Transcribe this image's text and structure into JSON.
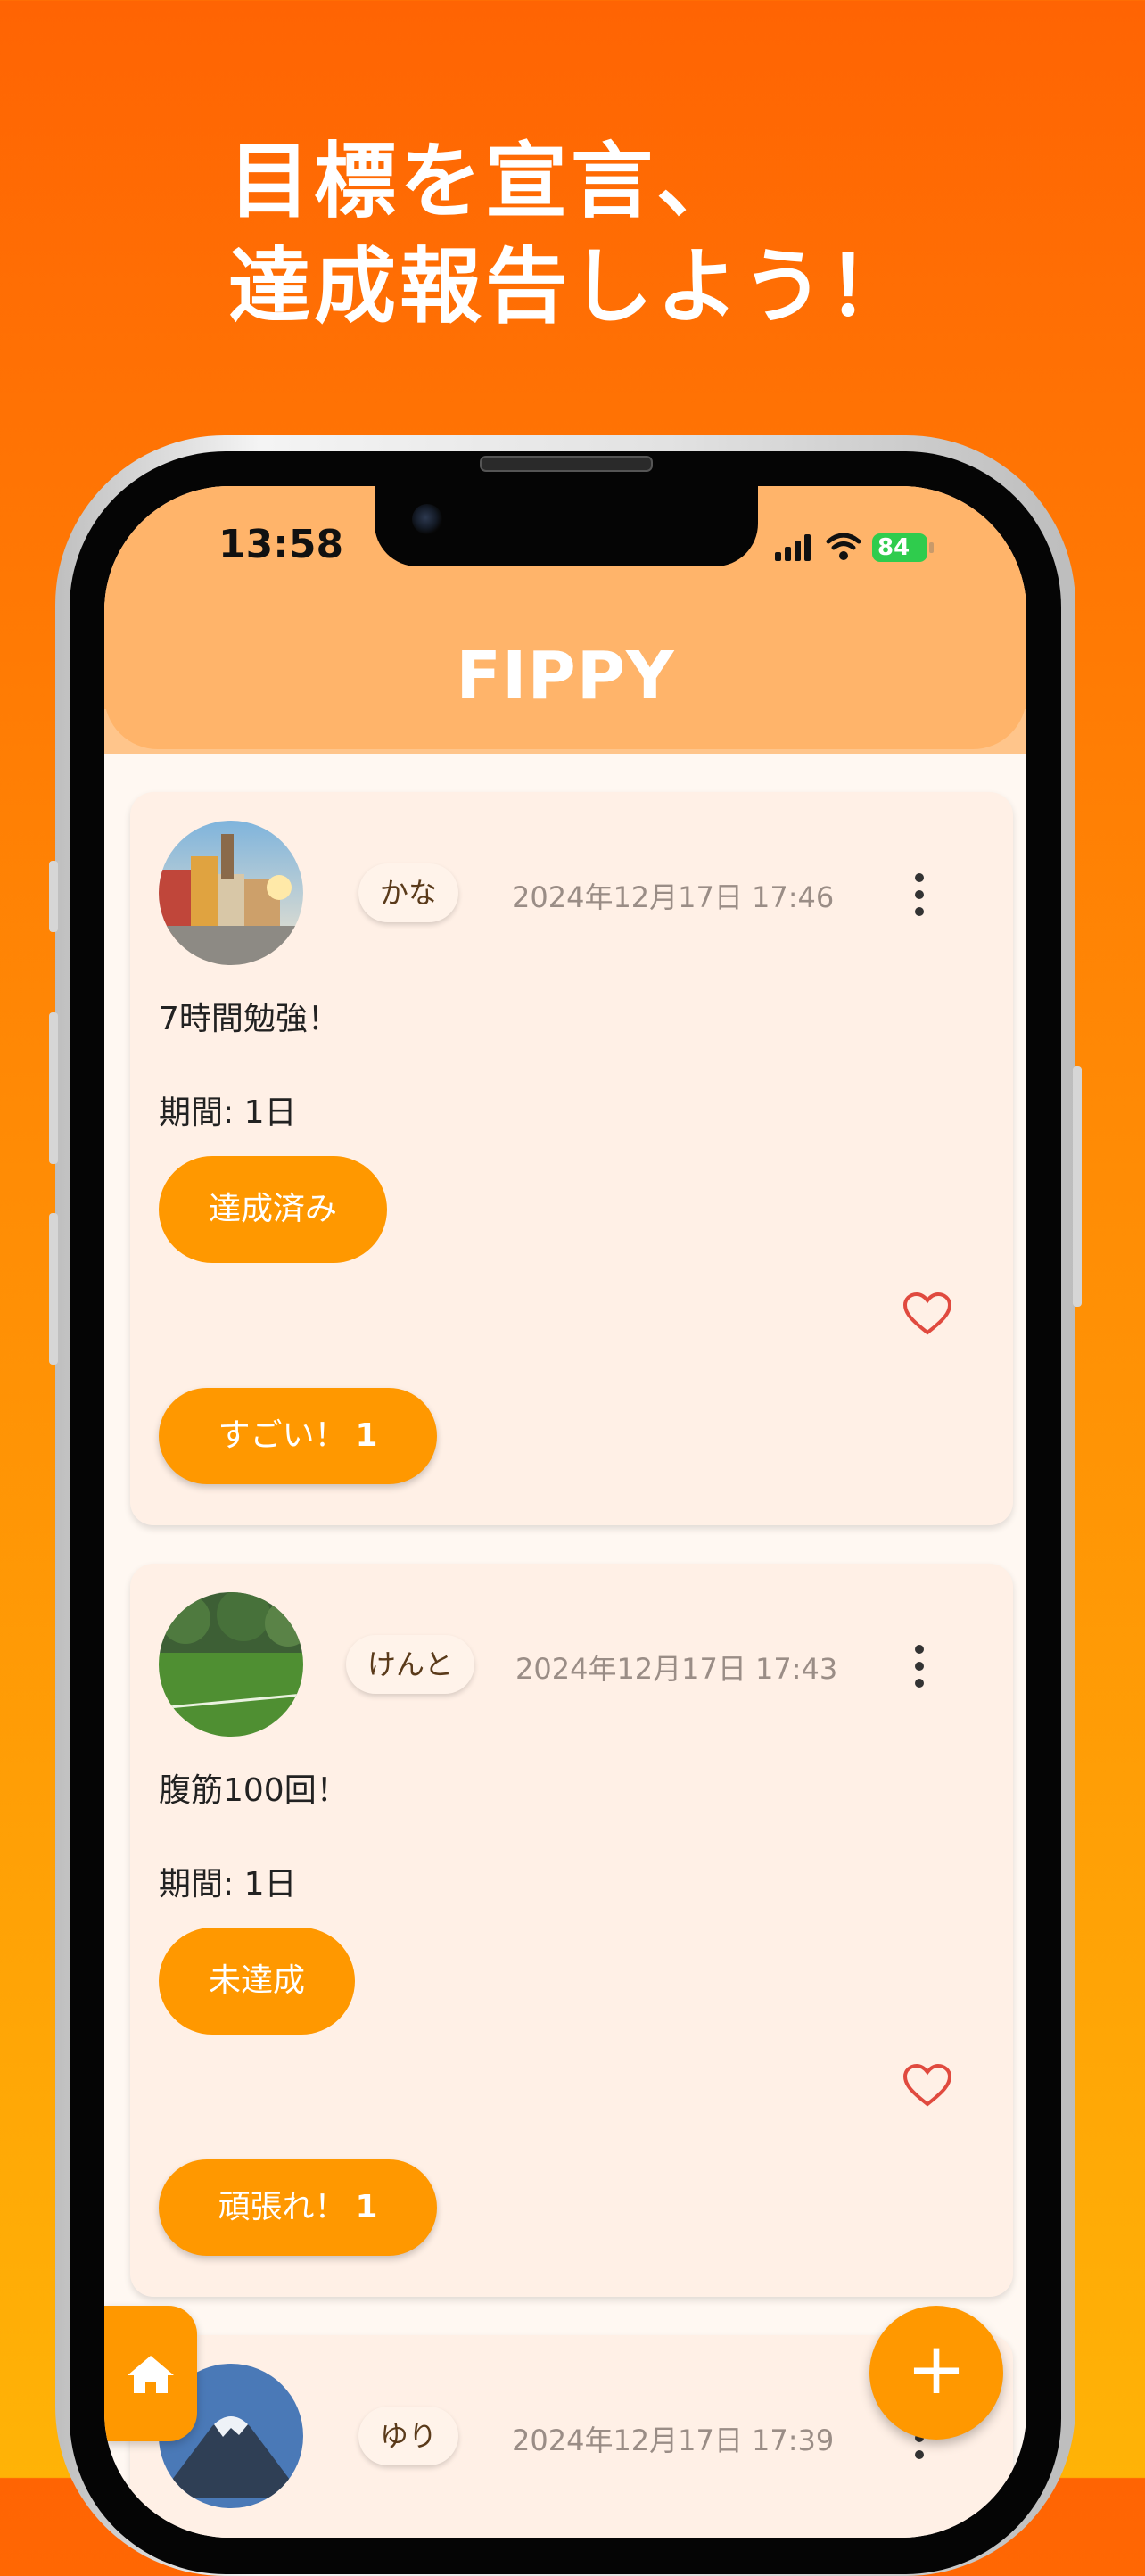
{
  "headline": {
    "line1": "目標を宣言、",
    "line2": "達成報告しよう！"
  },
  "status_bar": {
    "time": "13:58",
    "battery": "84"
  },
  "app": {
    "title": "FIPPY"
  },
  "posts": [
    {
      "user": "かな",
      "timestamp": "2024年12月17日 17:46",
      "goal": "7時間勉強！",
      "period": "期間: 1日",
      "status": "達成済み",
      "reaction_label": "すごい！",
      "reaction_count": "1"
    },
    {
      "user": "けんと",
      "timestamp": "2024年12月17日 17:43",
      "goal": "腹筋100回！",
      "period": "期間: 1日",
      "status": "未達成",
      "reaction_label": "頑張れ！",
      "reaction_count": "1"
    },
    {
      "user": "ゆり",
      "timestamp": "2024年12月17日 17:39"
    }
  ],
  "fab_label": "+",
  "colors": {
    "background_top": "#ff6403",
    "background_bottom": "#ffb306",
    "header": "#ffb46a",
    "accent": "#ff9800",
    "card": "#fff0e6"
  }
}
